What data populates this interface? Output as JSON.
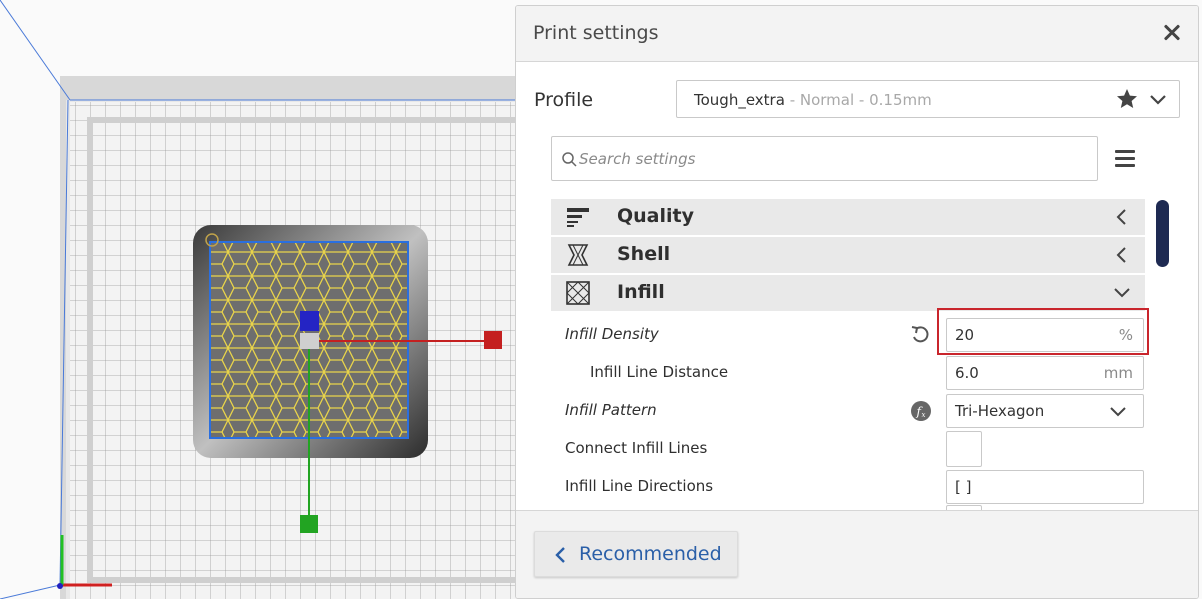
{
  "panel": {
    "title": "Print settings",
    "close_icon": "close-icon"
  },
  "profile": {
    "label": "Profile",
    "name": "Tough_extra",
    "sub": " - Normal - 0.15mm"
  },
  "search": {
    "placeholder": "Search settings"
  },
  "categories": [
    {
      "label": "Quality",
      "icon": "quality-icon",
      "expanded": false
    },
    {
      "label": "Shell",
      "icon": "shell-icon",
      "expanded": false
    },
    {
      "label": "Infill",
      "icon": "infill-icon",
      "expanded": true
    }
  ],
  "settings": [
    {
      "label": "Infill Density",
      "value": "20",
      "unit": "%",
      "italic": true,
      "icon": "reset-icon"
    },
    {
      "label": "Infill Line Distance",
      "value": "6.0",
      "unit": "mm",
      "italic": false
    },
    {
      "label": "Infill Pattern",
      "value": "Tri-Hexagon",
      "italic": true,
      "icon": "function-icon"
    },
    {
      "label": "Connect Infill Lines",
      "value": "",
      "italic": false
    },
    {
      "label": "Infill Line Directions",
      "value": "[ ]",
      "italic": false
    }
  ],
  "footer": {
    "recommended_label": "Recommended"
  },
  "colors": {
    "accent_blue": "#2a5fa8",
    "highlight_red": "#c9252c",
    "scrollbar": "#1e2a52",
    "infill_yellow": "#e9d44a"
  }
}
